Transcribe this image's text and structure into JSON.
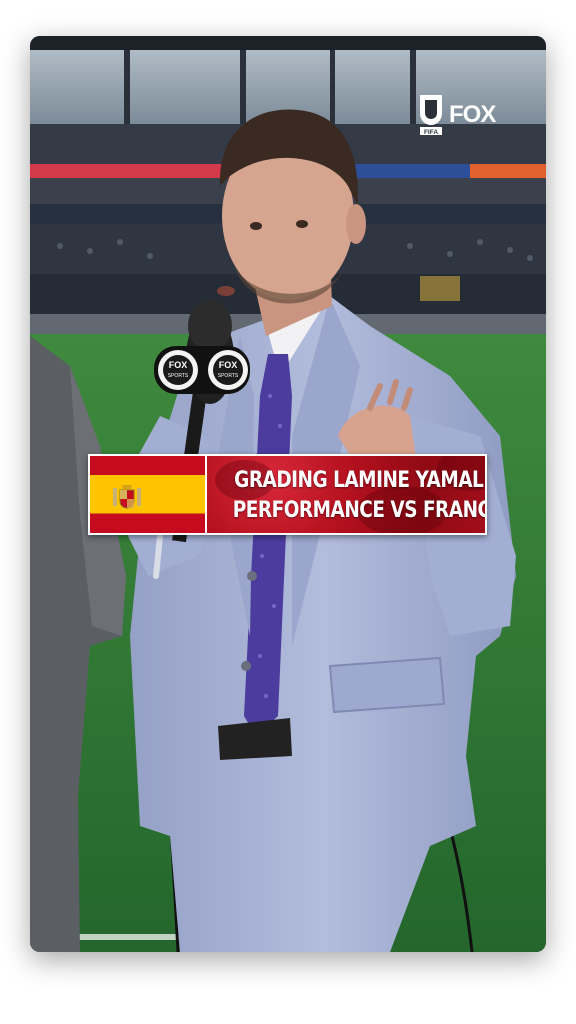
{
  "logo": {
    "brand": "FOX",
    "mark_label": "FIFA",
    "icon": "fifa-fox-logo-icon"
  },
  "overlay": {
    "headline_line1": "GRADING LAMINE YAMAL'S",
    "headline_line2": "PERFORMANCE VS FRANCE",
    "flag": "spain-flag-icon"
  },
  "mic": {
    "label": "FOX SPORTS"
  },
  "colors": {
    "flag_red": "#c60b1e",
    "flag_yellow": "#ffc400",
    "banner_red": "#b5111f",
    "suit": "#a9b4d6",
    "pitch": "#2f7a37"
  }
}
